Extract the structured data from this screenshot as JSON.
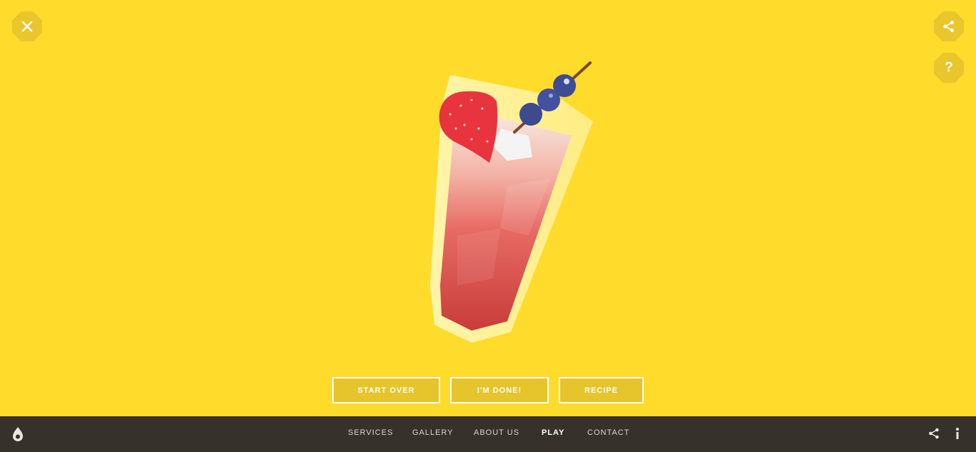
{
  "top_controls": {
    "close_icon": "close-icon",
    "share_icon": "share-icon",
    "help_label": "?"
  },
  "actions": {
    "start_over": "START OVER",
    "done": "I'M DONE!",
    "recipe": "RECIPE"
  },
  "footer": {
    "nav": [
      "SERVICES",
      "GALLERY",
      "ABOUT US",
      "PLAY",
      "CONTACT"
    ],
    "active": "PLAY"
  },
  "colors": {
    "background": "#FFDB2C",
    "button_fill": "#E9C62C",
    "footer": "#36322B"
  }
}
